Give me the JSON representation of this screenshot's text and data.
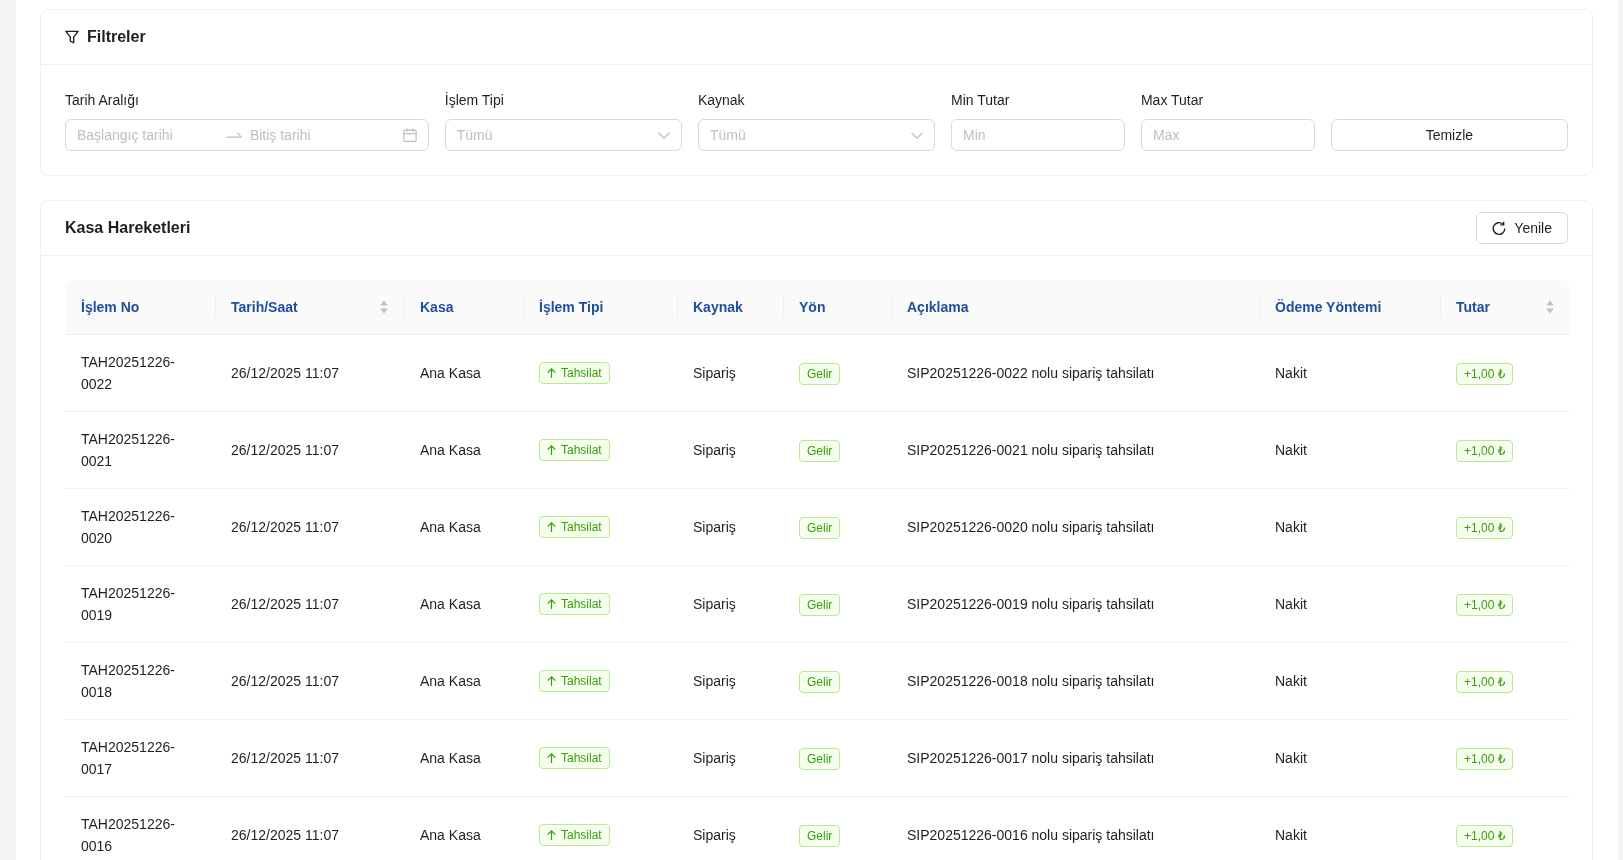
{
  "filters": {
    "title": "Filtreler",
    "fields": [
      {
        "kind": "date_range",
        "label": "Tarih Aralığı",
        "start": {
          "placeholder": "Başlangıç tarihi"
        },
        "end": {
          "placeholder": "Bitiş tarihi"
        }
      },
      {
        "kind": "select",
        "label": "İşlem Tipi",
        "placeholder": "Tümü"
      },
      {
        "kind": "select",
        "label": "Kaynak",
        "placeholder": "Tümü"
      },
      {
        "kind": "input",
        "label": "Min Tutar",
        "placeholder": "Min"
      },
      {
        "kind": "input",
        "label": "Max Tutar",
        "placeholder": "Max"
      },
      {
        "kind": "button",
        "label": "Temizle"
      }
    ]
  },
  "cash_movements": {
    "title": "Kasa Hareketleri",
    "refresh_button": {
      "label": "Yenile"
    },
    "table": {
      "columns": [
        {
          "label": "İşlem No",
          "sortable": false
        },
        {
          "label": "Tarih/Saat",
          "sortable": true
        },
        {
          "label": "Kasa",
          "sortable": false
        },
        {
          "label": "İşlem Tipi",
          "sortable": false
        },
        {
          "label": "Kaynak",
          "sortable": false
        },
        {
          "label": "Yön",
          "sortable": false
        },
        {
          "label": "Açıklama",
          "sortable": false
        },
        {
          "label": "Ödeme Yöntemi",
          "sortable": false
        },
        {
          "label": "Tutar",
          "sortable": true
        }
      ],
      "rows": [
        {
          "transaction_no": "TAH20251226-0022",
          "date_time": "26/12/2025 11:07",
          "cash_box": "Ana Kasa",
          "type": "Tahsilat",
          "source": "Sipariş",
          "direction": "Gelir",
          "description": "SIP20251226-0022 nolu sipariş tahsilatı",
          "payment_method": "Nakit",
          "amount": "+1,00 ₺"
        },
        {
          "transaction_no": "TAH20251226-0021",
          "date_time": "26/12/2025 11:07",
          "cash_box": "Ana Kasa",
          "type": "Tahsilat",
          "source": "Sipariş",
          "direction": "Gelir",
          "description": "SIP20251226-0021 nolu sipariş tahsilatı",
          "payment_method": "Nakit",
          "amount": "+1,00 ₺"
        },
        {
          "transaction_no": "TAH20251226-0020",
          "date_time": "26/12/2025 11:07",
          "cash_box": "Ana Kasa",
          "type": "Tahsilat",
          "source": "Sipariş",
          "direction": "Gelir",
          "description": "SIP20251226-0020 nolu sipariş tahsilatı",
          "payment_method": "Nakit",
          "amount": "+1,00 ₺"
        },
        {
          "transaction_no": "TAH20251226-0019",
          "date_time": "26/12/2025 11:07",
          "cash_box": "Ana Kasa",
          "type": "Tahsilat",
          "source": "Sipariş",
          "direction": "Gelir",
          "description": "SIP20251226-0019 nolu sipariş tahsilatı",
          "payment_method": "Nakit",
          "amount": "+1,00 ₺"
        },
        {
          "transaction_no": "TAH20251226-0018",
          "date_time": "26/12/2025 11:07",
          "cash_box": "Ana Kasa",
          "type": "Tahsilat",
          "source": "Sipariş",
          "direction": "Gelir",
          "description": "SIP20251226-0018 nolu sipariş tahsilatı",
          "payment_method": "Nakit",
          "amount": "+1,00 ₺"
        },
        {
          "transaction_no": "TAH20251226-0017",
          "date_time": "26/12/2025 11:07",
          "cash_box": "Ana Kasa",
          "type": "Tahsilat",
          "source": "Sipariş",
          "direction": "Gelir",
          "description": "SIP20251226-0017 nolu sipariş tahsilatı",
          "payment_method": "Nakit",
          "amount": "+1,00 ₺"
        },
        {
          "transaction_no": "TAH20251226-0016",
          "date_time": "26/12/2025 11:07",
          "cash_box": "Ana Kasa",
          "type": "Tahsilat",
          "source": "Sipariş",
          "direction": "Gelir",
          "description": "SIP20251226-0016 nolu sipariş tahsilatı",
          "payment_method": "Nakit",
          "amount": "+1,00 ₺"
        }
      ]
    }
  }
}
